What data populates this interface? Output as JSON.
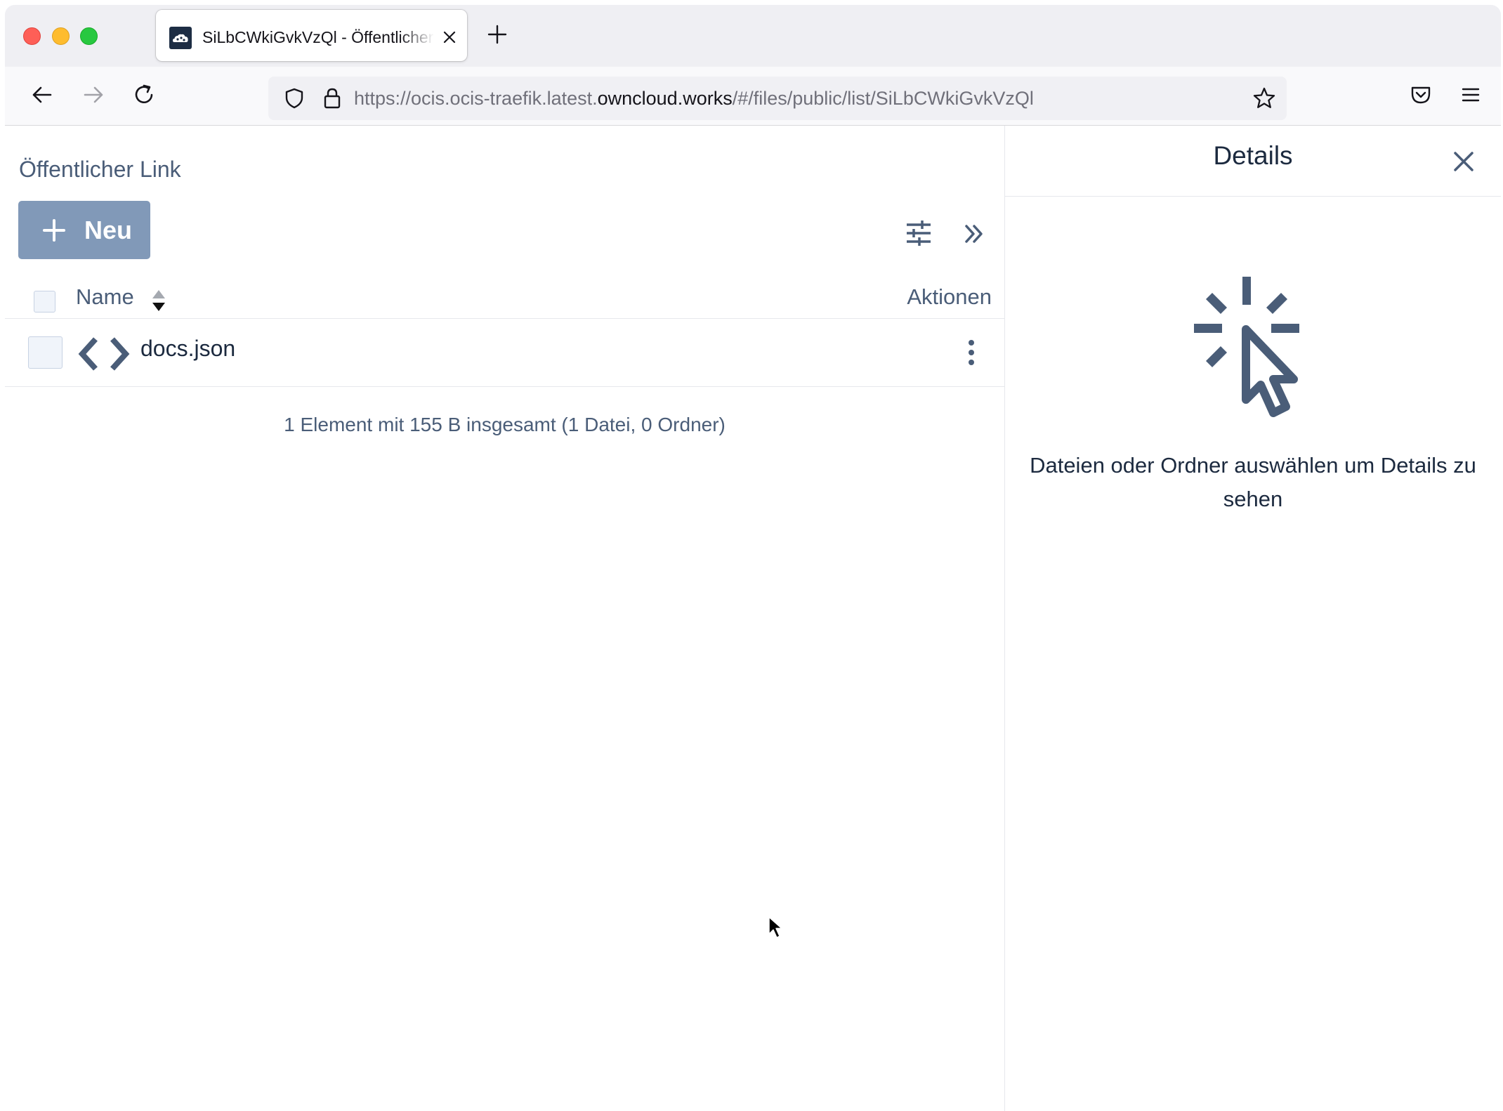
{
  "browser": {
    "tab": {
      "title": "SiLbCWkiGvkVzQl - Öffentlicher Link - ownCloud"
    },
    "url": {
      "prefix": "https://ocis.ocis-traefik.latest.",
      "host": "owncloud.works",
      "path": "/#/files/public/list/SiLbCWkiGvkVzQl"
    }
  },
  "page": {
    "breadcrumb": "Öffentlicher Link",
    "new_button_label": "Neu",
    "table": {
      "columns": {
        "name": "Name",
        "actions": "Aktionen"
      },
      "rows": [
        {
          "name": "docs.json",
          "icon": "code-icon"
        }
      ]
    },
    "summary": "1 Element mit 155 B insgesamt (1 Datei, 0 Ordner)"
  },
  "sidebar": {
    "title": "Details",
    "empty_message": "Dateien oder Ordner auswählen um Details zu sehen"
  },
  "colors": {
    "accent": "#8199b8",
    "text": "#4a5d78",
    "heading": "#1c2a3f"
  }
}
